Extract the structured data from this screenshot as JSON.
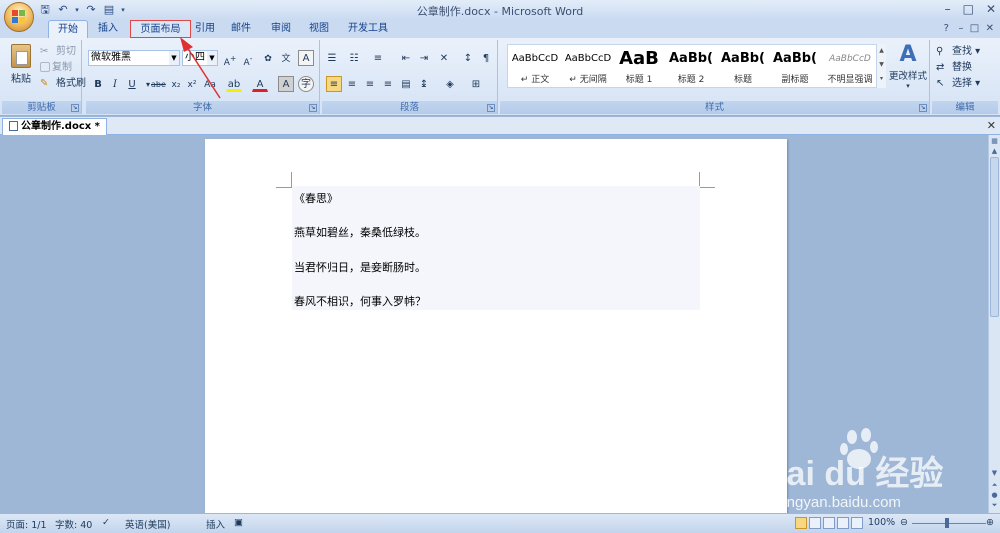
{
  "window": {
    "title": "公章制作.docx - Microsoft Word"
  },
  "tabs": [
    {
      "label": "开始"
    },
    {
      "label": "插入"
    },
    {
      "label": "页面布局"
    },
    {
      "label": "引用"
    },
    {
      "label": "邮件"
    },
    {
      "label": "审阅"
    },
    {
      "label": "视图"
    },
    {
      "label": "开发工具"
    }
  ],
  "clipboard": {
    "paste": "粘贴",
    "cut": "剪切",
    "copy": "复制",
    "format_painter": "格式刷",
    "group_label": "剪贴板"
  },
  "font": {
    "font_name": "微软雅黑",
    "font_size": "小四",
    "group_label": "字体"
  },
  "paragraph": {
    "group_label": "段落"
  },
  "styles": {
    "group_label": "样式",
    "change_styles": "更改样式",
    "items": [
      {
        "sample": "AaBbCcD",
        "name": "↵ 正文"
      },
      {
        "sample": "AaBbCcD",
        "name": "↵ 无间隔"
      },
      {
        "sample": "AaB",
        "name": "标题 1"
      },
      {
        "sample": "AaBb(",
        "name": "标题 2"
      },
      {
        "sample": "AaBb(",
        "name": "标题"
      },
      {
        "sample": "AaBb(",
        "name": "副标题"
      },
      {
        "sample": "AaBbCcD",
        "name": "不明显强调"
      }
    ]
  },
  "editing": {
    "find": "查找",
    "replace": "替换",
    "select": "选择",
    "group_label": "编辑"
  },
  "document": {
    "tab_name": "公章制作.docx *",
    "paragraphs": [
      "《春思》",
      "燕草如碧丝，秦桑低绿枝。",
      "当君怀归日，是妾断肠时。",
      "春风不相识，何事入罗帏？"
    ]
  },
  "status": {
    "page": "页面: 1/1",
    "words": "字数: 40",
    "language": "英语(美国)",
    "mode": "插入",
    "zoom": "100%"
  },
  "watermark": {
    "brand": "Bai du 经验",
    "url": "jingyan.baidu.com"
  },
  "colors": {
    "highlight_border": "#e04848",
    "annotation_arrow": "#e03030"
  }
}
